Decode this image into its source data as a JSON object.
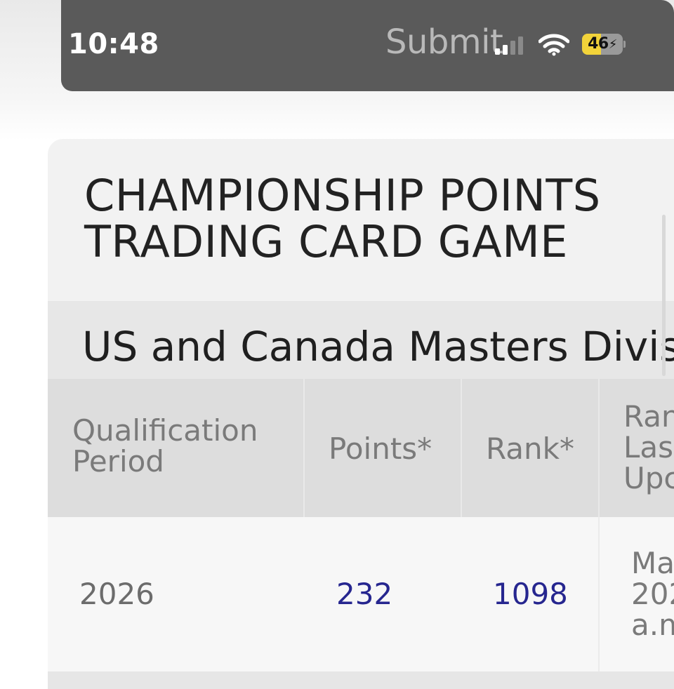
{
  "status_bar": {
    "time": "10:48",
    "app_label": "Submit",
    "battery_level": "46",
    "battery_percent": 46
  },
  "card": {
    "title_line1": "CHAMPIONSHIP POINTS",
    "title_line2": "TRADING CARD GAME",
    "division_title": "US and Canada Masters Divis",
    "table": {
      "headers": {
        "qualification_period": "Qualification Period",
        "points": "Points*",
        "rank": "Rank*",
        "rank_last_updated": "Ran Las Upc"
      },
      "rows": [
        {
          "qualification_period": "2026",
          "points": "232",
          "rank": "1098",
          "updated": "Ma 202 a.m"
        }
      ]
    }
  },
  "colors": {
    "status_bar_bg": "#5a5a5a",
    "battery_fill": "#f2d33a",
    "link_value": "#26268f",
    "header_text": "#7a7a7a",
    "title_text": "#222222"
  }
}
